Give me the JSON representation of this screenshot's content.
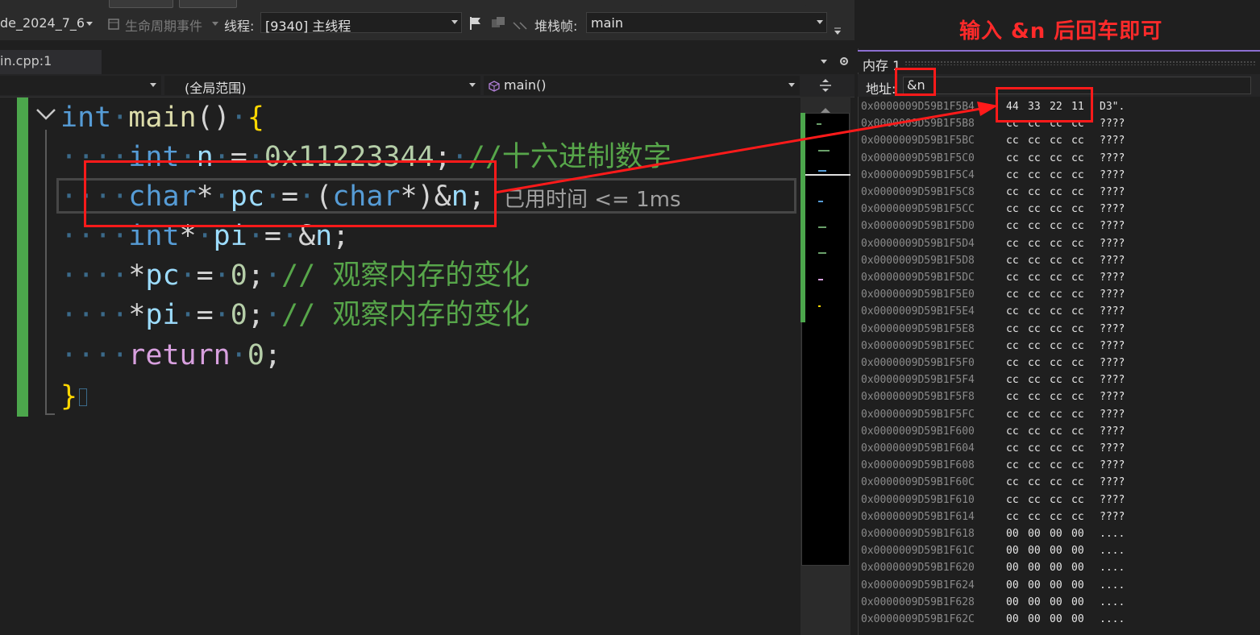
{
  "toolbar": {
    "process_label": "de_2024_7_6",
    "lifecycle_label": "生命周期事件",
    "thread_label": "线程:",
    "thread_value": "[9340] 主线程",
    "stackframe_label": "堆栈帧:",
    "stackframe_value": "main"
  },
  "annotation": {
    "hint": "输入  &n  后回车即可"
  },
  "editor": {
    "file_tab": "in.cpp:1",
    "scope_combo": "(全局范围)",
    "function_combo": "main()",
    "elapsed_hint": "已用时间 <= 1ms",
    "code": {
      "line1": {
        "kw": "int",
        "fn": "main",
        "paren": "()",
        "brace": "{"
      },
      "line2": {
        "kw": "int",
        "var": "n",
        "op": "=",
        "num": "0x11223344",
        "semi": ";",
        "comment": "//十六进制数字"
      },
      "line3": {
        "kw1": "char",
        "star1": "*",
        "var": "pc",
        "op": "=",
        "open": "(",
        "kw2": "char",
        "star2": "*",
        "close": ")",
        "amp": "&",
        "var2": "n",
        "semi": ";"
      },
      "line4": {
        "kw": "int",
        "star": "*",
        "var": "pi",
        "op": "=",
        "amp": "&",
        "var2": "n",
        "semi": ";"
      },
      "line5": {
        "star": "*",
        "var": "pc",
        "op": "=",
        "num": "0",
        "semi": ";",
        "comment": "// 观察内存的变化"
      },
      "line6": {
        "star": "*",
        "var": "pi",
        "op": "=",
        "num": "0",
        "semi": ";",
        "comment": "// 观察内存的变化"
      },
      "line7": {
        "kw": "return",
        "num": "0",
        "semi": ";"
      },
      "line8": {
        "brace": "}"
      }
    }
  },
  "memory": {
    "title": "内存 1",
    "address_label": "地址:",
    "address_value": "&n",
    "rows": [
      {
        "addr": "0x0000009D59B1F5B4",
        "bytes": [
          "44",
          "33",
          "22",
          "11"
        ],
        "ascii": "D3\"."
      },
      {
        "addr": "0x0000009D59B1F5B8",
        "bytes": [
          "cc",
          "cc",
          "cc",
          "cc"
        ],
        "ascii": "????"
      },
      {
        "addr": "0x0000009D59B1F5BC",
        "bytes": [
          "cc",
          "cc",
          "cc",
          "cc"
        ],
        "ascii": "????"
      },
      {
        "addr": "0x0000009D59B1F5C0",
        "bytes": [
          "cc",
          "cc",
          "cc",
          "cc"
        ],
        "ascii": "????"
      },
      {
        "addr": "0x0000009D59B1F5C4",
        "bytes": [
          "cc",
          "cc",
          "cc",
          "cc"
        ],
        "ascii": "????"
      },
      {
        "addr": "0x0000009D59B1F5C8",
        "bytes": [
          "cc",
          "cc",
          "cc",
          "cc"
        ],
        "ascii": "????"
      },
      {
        "addr": "0x0000009D59B1F5CC",
        "bytes": [
          "cc",
          "cc",
          "cc",
          "cc"
        ],
        "ascii": "????"
      },
      {
        "addr": "0x0000009D59B1F5D0",
        "bytes": [
          "cc",
          "cc",
          "cc",
          "cc"
        ],
        "ascii": "????"
      },
      {
        "addr": "0x0000009D59B1F5D4",
        "bytes": [
          "cc",
          "cc",
          "cc",
          "cc"
        ],
        "ascii": "????"
      },
      {
        "addr": "0x0000009D59B1F5D8",
        "bytes": [
          "cc",
          "cc",
          "cc",
          "cc"
        ],
        "ascii": "????"
      },
      {
        "addr": "0x0000009D59B1F5DC",
        "bytes": [
          "cc",
          "cc",
          "cc",
          "cc"
        ],
        "ascii": "????"
      },
      {
        "addr": "0x0000009D59B1F5E0",
        "bytes": [
          "cc",
          "cc",
          "cc",
          "cc"
        ],
        "ascii": "????"
      },
      {
        "addr": "0x0000009D59B1F5E4",
        "bytes": [
          "cc",
          "cc",
          "cc",
          "cc"
        ],
        "ascii": "????"
      },
      {
        "addr": "0x0000009D59B1F5E8",
        "bytes": [
          "cc",
          "cc",
          "cc",
          "cc"
        ],
        "ascii": "????"
      },
      {
        "addr": "0x0000009D59B1F5EC",
        "bytes": [
          "cc",
          "cc",
          "cc",
          "cc"
        ],
        "ascii": "????"
      },
      {
        "addr": "0x0000009D59B1F5F0",
        "bytes": [
          "cc",
          "cc",
          "cc",
          "cc"
        ],
        "ascii": "????"
      },
      {
        "addr": "0x0000009D59B1F5F4",
        "bytes": [
          "cc",
          "cc",
          "cc",
          "cc"
        ],
        "ascii": "????"
      },
      {
        "addr": "0x0000009D59B1F5F8",
        "bytes": [
          "cc",
          "cc",
          "cc",
          "cc"
        ],
        "ascii": "????"
      },
      {
        "addr": "0x0000009D59B1F5FC",
        "bytes": [
          "cc",
          "cc",
          "cc",
          "cc"
        ],
        "ascii": "????"
      },
      {
        "addr": "0x0000009D59B1F600",
        "bytes": [
          "cc",
          "cc",
          "cc",
          "cc"
        ],
        "ascii": "????"
      },
      {
        "addr": "0x0000009D59B1F604",
        "bytes": [
          "cc",
          "cc",
          "cc",
          "cc"
        ],
        "ascii": "????"
      },
      {
        "addr": "0x0000009D59B1F608",
        "bytes": [
          "cc",
          "cc",
          "cc",
          "cc"
        ],
        "ascii": "????"
      },
      {
        "addr": "0x0000009D59B1F60C",
        "bytes": [
          "cc",
          "cc",
          "cc",
          "cc"
        ],
        "ascii": "????"
      },
      {
        "addr": "0x0000009D59B1F610",
        "bytes": [
          "cc",
          "cc",
          "cc",
          "cc"
        ],
        "ascii": "????"
      },
      {
        "addr": "0x0000009D59B1F614",
        "bytes": [
          "cc",
          "cc",
          "cc",
          "cc"
        ],
        "ascii": "????"
      },
      {
        "addr": "0x0000009D59B1F618",
        "bytes": [
          "00",
          "00",
          "00",
          "00"
        ],
        "ascii": "...."
      },
      {
        "addr": "0x0000009D59B1F61C",
        "bytes": [
          "00",
          "00",
          "00",
          "00"
        ],
        "ascii": "...."
      },
      {
        "addr": "0x0000009D59B1F620",
        "bytes": [
          "00",
          "00",
          "00",
          "00"
        ],
        "ascii": "...."
      },
      {
        "addr": "0x0000009D59B1F624",
        "bytes": [
          "00",
          "00",
          "00",
          "00"
        ],
        "ascii": "...."
      },
      {
        "addr": "0x0000009D59B1F628",
        "bytes": [
          "00",
          "00",
          "00",
          "00"
        ],
        "ascii": "...."
      },
      {
        "addr": "0x0000009D59B1F62C",
        "bytes": [
          "00",
          "00",
          "00",
          "00"
        ],
        "ascii": "...."
      }
    ]
  },
  "colors": {
    "annotation": "#ff1a1a",
    "breakpoint_gutter": "#4ca64c",
    "keyword": "#569cd6",
    "function": "#dcdcaa",
    "variable": "#9cdcfe",
    "number": "#b5cea8",
    "comment": "#57a64a",
    "control": "#d8a0df"
  }
}
